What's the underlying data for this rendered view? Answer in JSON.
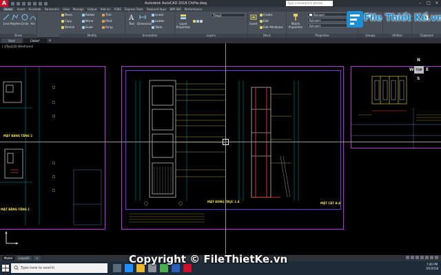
{
  "window": {
    "title": "Autodesk AutoCAD 2016   ChiHa.dwg",
    "search_placeholder": "Type a keyword or phrase"
  },
  "ribbon_tabs": [
    "Home",
    "Insert",
    "Annotate",
    "Parametric",
    "View",
    "Manage",
    "Output",
    "Add-ins",
    "A360",
    "Express Tools",
    "Featured Apps",
    "BIM 360",
    "Performance"
  ],
  "ribbon": {
    "draw": {
      "label": "Draw",
      "tools": [
        "Line",
        "Polyline",
        "Circle",
        "Arc"
      ]
    },
    "modify": {
      "label": "Modify",
      "tools": [
        "Move",
        "Rotate",
        "Trim",
        "Copy",
        "Mirror",
        "Fillet",
        "Stretch",
        "Scale",
        "Array"
      ]
    },
    "annotation": {
      "label": "Annotation",
      "tools": [
        "Text",
        "Dimension",
        "Linear",
        "Leader",
        "Table"
      ]
    },
    "layers": {
      "label": "Layers",
      "tools": [
        "Layer Properties"
      ],
      "current_layer": "Thep2"
    },
    "block": {
      "label": "Block",
      "tools": [
        "Insert",
        "Create",
        "Edit",
        "Edit Attributes"
      ]
    },
    "properties": {
      "label": "Properties",
      "tools": [
        "Match Properties"
      ],
      "color": "ByLayer",
      "linetype": "ByLayer",
      "lineweight": "ByLayer"
    },
    "groups": {
      "label": "Groups"
    },
    "utilities": {
      "label": "Utilities"
    },
    "clipboard": {
      "label": "Clipboard"
    }
  },
  "file_tabs": [
    "Start",
    "ChiHa*"
  ],
  "viewport": {
    "label": "[-][Top][2D Wireframe]",
    "viewcube_face": "TOP",
    "compass": {
      "n": "N",
      "w": "W",
      "e": "E",
      "s": "S"
    }
  },
  "drawings": {
    "plan_floor_2": "MẶT BẰNG TẦNG 2",
    "plan_floor_1": "MẶT BẰNG TẦNG 1",
    "front_elevation": "MẶT ĐỨNG TRỤC 1-4",
    "section": "MẶT CẮT A-A"
  },
  "layout_tabs": [
    "Model",
    "Layout1"
  ],
  "taskbar": {
    "search_placeholder": "Type here to search",
    "time": "7:40 PM",
    "date": "3/5/2018"
  },
  "watermark": {
    "brand": "File Thiết Kế",
    "domain_suffix": ".vn",
    "copyright": "Copyright © FileThietKe.vn"
  }
}
